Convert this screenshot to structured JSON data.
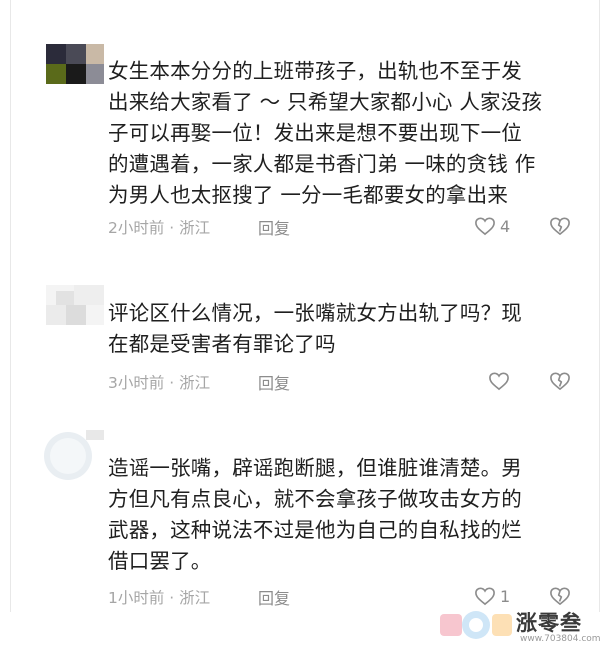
{
  "comments": [
    {
      "text_lines": [
        "女生本本分分的上班带孩子，出轨也不至于发",
        "出来给大家看了 ～ 只希望大家都小心 人家没孩",
        "子可以再娶一位！发出来是想不要出现下一位",
        "的遭遇着，一家人都是书香门弟 一味的贪钱 作",
        "为男人也太抠搜了 一分一毛都要女的拿出来"
      ],
      "meta": "2小时前 · 浙江",
      "reply": "回复",
      "likes": "4"
    },
    {
      "text_lines": [
        "评论区什么情况，一张嘴就女方出轨了吗？现",
        "在都是受害者有罪论了吗"
      ],
      "meta": "3小时前 · 浙江",
      "reply": "回复",
      "likes": ""
    },
    {
      "text_lines": [
        "造谣一张嘴，辟谣跑断腿，但谁脏谁清楚。男",
        "方但凡有点良心，就不会拿孩子做攻击女方的",
        "武器，这种说法不过是他为自己的自私找的烂",
        "借口罢了。"
      ],
      "meta": "1小时前 · 浙江",
      "reply": "回复",
      "likes": "1"
    }
  ],
  "icons": {
    "like": "heart-outline-icon",
    "dislike": "broken-heart-icon"
  },
  "watermark": {
    "text": "涨零叁",
    "sub": "www.703804.com"
  },
  "colors": {
    "text": "#1f1f1f",
    "meta": "#a6a6a6",
    "icon": "#8c8c8c"
  }
}
